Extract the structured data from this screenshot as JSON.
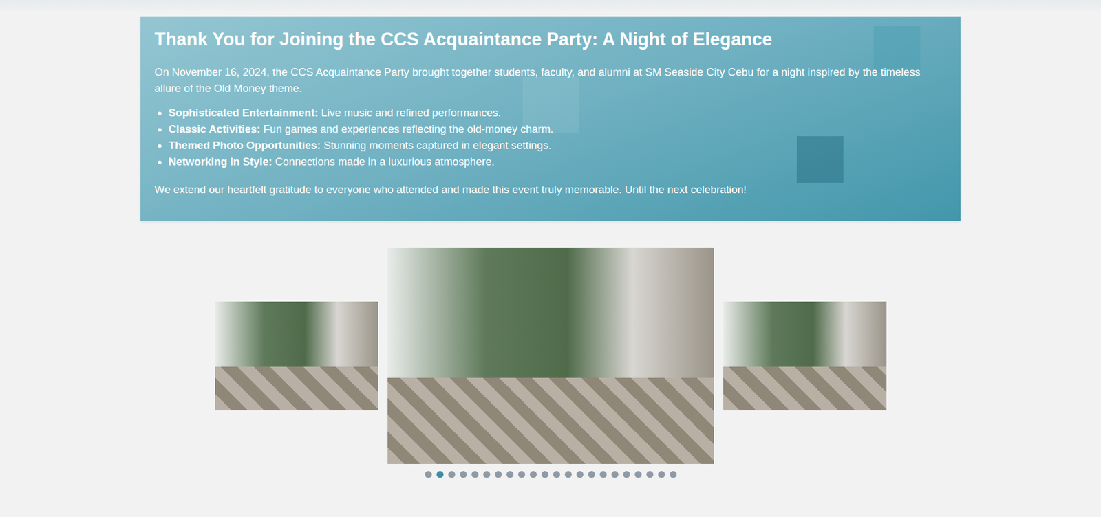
{
  "banner": {
    "title": "Thank You for Joining the CCS Acquaintance Party: A Night of Elegance",
    "intro": "On November 16, 2024, the CCS Acquaintance Party brought together students, faculty, and alumni at SM Seaside City Cebu for a night inspired by the timeless allure of the Old Money theme.",
    "highlights": [
      {
        "label": "Sophisticated Entertainment:",
        "text": "Live music and refined performances."
      },
      {
        "label": "Classic Activities:",
        "text": "Fun games and experiences reflecting the old-money charm."
      },
      {
        "label": "Themed Photo Opportunities:",
        "text": "Stunning moments captured in elegant settings."
      },
      {
        "label": "Networking in Style:",
        "text": "Connections made in a luxurious atmosphere."
      }
    ],
    "closing": "We extend our heartfelt gratitude to everyone who attended and made this event truly memorable. Until the next celebration!"
  },
  "carousel": {
    "slides": [
      {
        "kind": "side"
      },
      {
        "kind": "center"
      },
      {
        "kind": "side"
      }
    ],
    "dots": [
      {
        "selected": false
      },
      {
        "selected": true
      },
      {
        "selected": false
      },
      {
        "selected": false
      },
      {
        "selected": false
      },
      {
        "selected": false
      },
      {
        "selected": false
      },
      {
        "selected": false
      },
      {
        "selected": false
      },
      {
        "selected": false
      },
      {
        "selected": false
      },
      {
        "selected": false
      },
      {
        "selected": false
      },
      {
        "selected": false
      },
      {
        "selected": false
      },
      {
        "selected": false
      },
      {
        "selected": false
      },
      {
        "selected": false
      },
      {
        "selected": false
      },
      {
        "selected": false
      },
      {
        "selected": false
      },
      {
        "selected": false
      }
    ]
  }
}
